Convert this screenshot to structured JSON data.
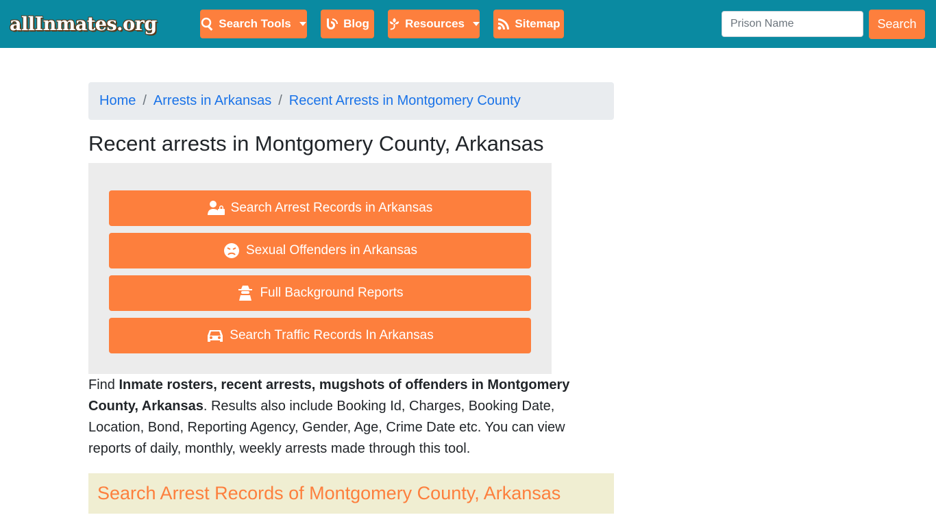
{
  "navbar": {
    "logo_text": "allInmates.org",
    "menu": [
      {
        "label": "Search Tools",
        "icon": "search-icon",
        "dropdown": true
      },
      {
        "label": "Blog",
        "icon": "blog-icon",
        "dropdown": false
      },
      {
        "label": "Resources",
        "icon": "leaf-icon",
        "dropdown": true
      },
      {
        "label": "Sitemap",
        "icon": "rss-icon",
        "dropdown": false
      }
    ],
    "search": {
      "placeholder": "Prison Name",
      "value": "",
      "button_label": "Search"
    }
  },
  "breadcrumb": [
    {
      "label": "Home"
    },
    {
      "label": "Arrests in Arkansas"
    },
    {
      "label": "Recent Arrests in Montgomery County"
    }
  ],
  "page_title": "Recent arrests in Montgomery County, Arkansas",
  "actions": [
    {
      "label": "Search Arrest Records in Arkansas",
      "icon": "user-lock-icon"
    },
    {
      "label": "Sexual Offenders in Arkansas",
      "icon": "angry-face-icon"
    },
    {
      "label": "Full Background Reports",
      "icon": "user-secret-icon"
    },
    {
      "label": "Search Traffic Records In Arkansas",
      "icon": "car-icon"
    }
  ],
  "description": {
    "prefix": "Find ",
    "bold": "Inmate rosters, recent arrests, mugshots of offenders in Montgomery County, Arkansas",
    "suffix": ". Results also include Booking Id, Charges, Booking Date, Location, Bond, Reporting Agency, Gender, Age, Crime Date etc. You can view reports of daily, monthly, weekly arrests made through this tool."
  },
  "section_heading": "Search Arrest Records of Montgomery County, Arkansas",
  "colors": {
    "navbar": "#0a8aa1",
    "accent": "#fd7f3d",
    "link": "#1a73e8",
    "banner": "#f0eed2"
  }
}
